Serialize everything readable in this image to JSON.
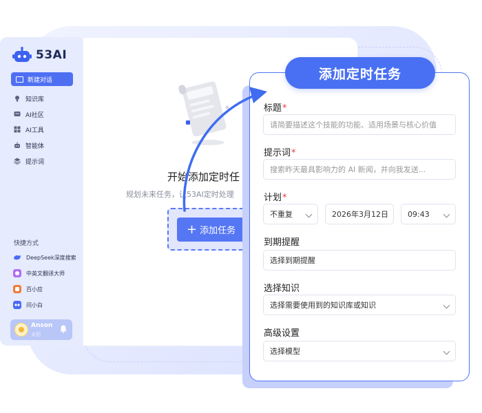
{
  "sidebar": {
    "logo_text": "53AI",
    "new_chat_label": "新建对话",
    "items": [
      {
        "label": "知识库",
        "icon": "bulb-icon"
      },
      {
        "label": "AI社区",
        "icon": "chat-icon"
      },
      {
        "label": "AI工具",
        "icon": "grid-icon"
      },
      {
        "label": "智能体",
        "icon": "robot-icon"
      },
      {
        "label": "提示词",
        "icon": "layers-icon"
      }
    ],
    "shortcut_title": "快捷方式",
    "shortcuts": [
      {
        "label": "DeepSeek深度搜索",
        "color": "#4a6cf4"
      },
      {
        "label": "中英文翻译大师",
        "color": "#b26ef0"
      },
      {
        "label": "百小应",
        "color": "#f07c3a"
      },
      {
        "label": "问小白",
        "color": "#4a6cf4"
      }
    ],
    "user": {
      "name": "Anson",
      "subtitle": "太阳"
    }
  },
  "main": {
    "empty_title": "开始添加定时任",
    "empty_subtitle": "规划未来任务，让53AI定时处理",
    "add_button_label": "添加任务"
  },
  "modal": {
    "title": "添加定时任务",
    "title_field": {
      "label": "标题",
      "required": "*",
      "placeholder": "请简要描述这个技能的功能、适用场景与核心价值"
    },
    "prompt_field": {
      "label": "提示词",
      "required": "*",
      "placeholder": "搜索昨天最具影响力的 AI 新闻，并向我发送..."
    },
    "plan_field": {
      "label": "计划",
      "required": "*",
      "repeat": "不重复",
      "date": "2026年3月12日",
      "time": "09:43"
    },
    "reminder_field": {
      "label": "到期提醒",
      "value": "选择到期提醒"
    },
    "knowledge_field": {
      "label": "选择知识",
      "value": "选择需要使用到的知识库或知识"
    },
    "advanced_field": {
      "label": "高级设置",
      "value": "选择模型"
    }
  },
  "colors": {
    "accent": "#4f6ff3",
    "sidebar_bg": "#e6ebfd",
    "required": "#e04040"
  }
}
